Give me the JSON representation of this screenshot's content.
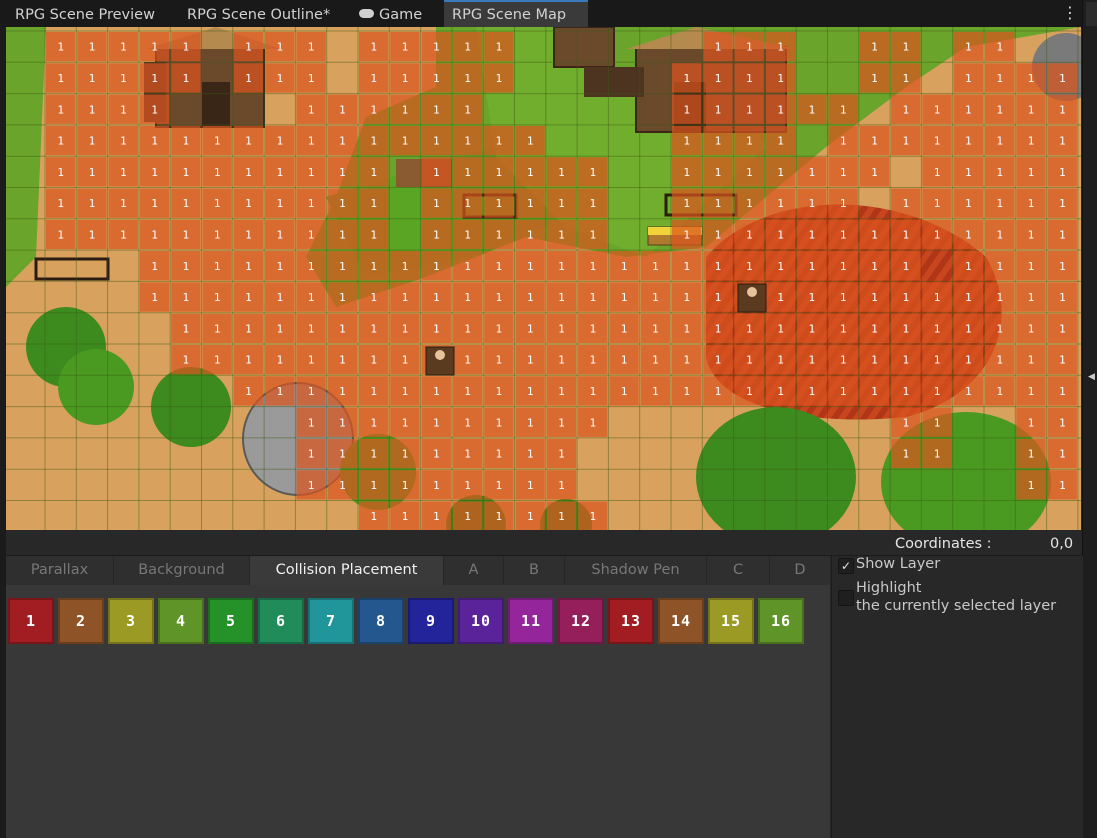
{
  "tabs": [
    {
      "label": "RPG Scene Preview",
      "active": false,
      "icon": null
    },
    {
      "label": "RPG Scene Outline*",
      "active": false,
      "icon": null
    },
    {
      "label": "Game",
      "active": false,
      "icon": "gamepad-icon"
    },
    {
      "label": "RPG Scene Map",
      "active": true,
      "icon": null
    }
  ],
  "menu_icon": "kebab-menu-icon",
  "map": {
    "collision_marker": "1",
    "colors": {
      "grass": "#6aa42b",
      "dirt": "#c98a4e",
      "collision_overlay": "#d9541f",
      "grid": "#5d7d2a",
      "wood": "#6b4a2c",
      "tree": "#3d8a1e",
      "rock": "#9a9a9a"
    }
  },
  "coordinates": {
    "label": "Coordinates :",
    "value": "0,0"
  },
  "layer_tabs": [
    {
      "label": "Parallax",
      "active": false
    },
    {
      "label": "Background",
      "active": false
    },
    {
      "label": "Collision Placement",
      "active": true
    },
    {
      "label": "A",
      "active": false
    },
    {
      "label": "B",
      "active": false
    },
    {
      "label": "Shadow Pen",
      "active": false
    },
    {
      "label": "C",
      "active": false
    },
    {
      "label": "D",
      "active": false
    }
  ],
  "collision_swatches": [
    {
      "label": "1",
      "color": "#a11d22"
    },
    {
      "label": "2",
      "color": "#8e5326"
    },
    {
      "label": "3",
      "color": "#9b9a24"
    },
    {
      "label": "4",
      "color": "#5f9429"
    },
    {
      "label": "5",
      "color": "#259129"
    },
    {
      "label": "6",
      "color": "#1f8c5a"
    },
    {
      "label": "7",
      "color": "#21969a"
    },
    {
      "label": "8",
      "color": "#23578e"
    },
    {
      "label": "9",
      "color": "#23239a"
    },
    {
      "label": "10",
      "color": "#5a2399"
    },
    {
      "label": "11",
      "color": "#94259a"
    },
    {
      "label": "12",
      "color": "#941f5b"
    },
    {
      "label": "13",
      "color": "#a11d22"
    },
    {
      "label": "14",
      "color": "#8e5326"
    },
    {
      "label": "15",
      "color": "#9b9a24"
    },
    {
      "label": "16",
      "color": "#5f9429"
    }
  ],
  "inspector": {
    "show_layer": {
      "label": "Show Layer",
      "checked": true
    },
    "highlight": {
      "label_line1": "Highlight",
      "label_line2": "the currently selected layer",
      "checked": false
    }
  },
  "accent": "#3a79bb"
}
